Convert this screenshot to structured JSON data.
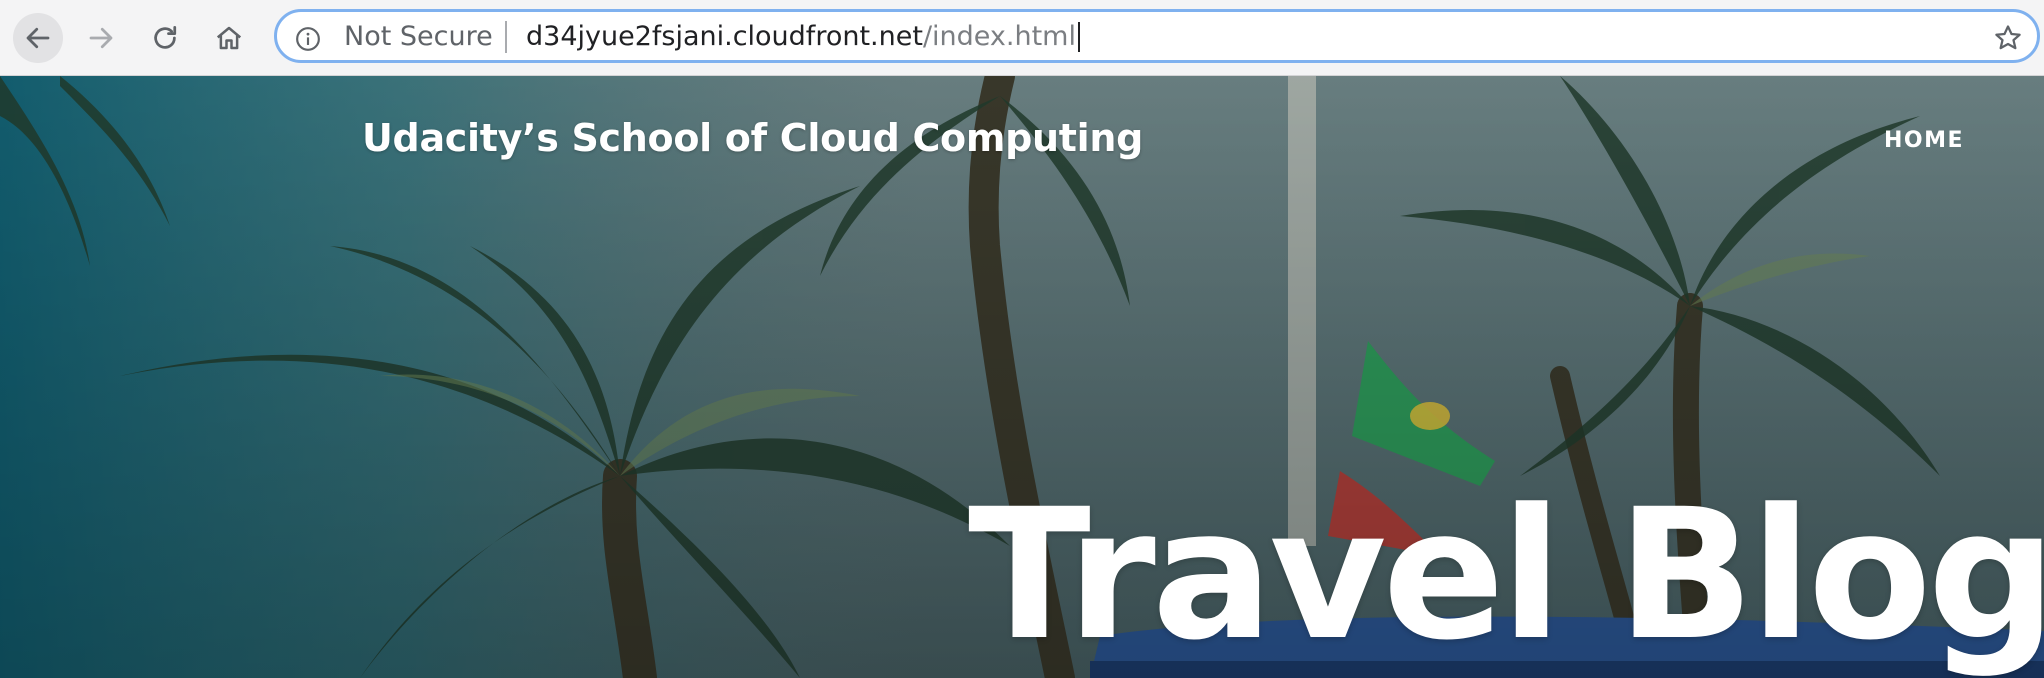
{
  "browser": {
    "security_label": "Not Secure",
    "url_host": "d34jyue2fsjani.cloudfront.net",
    "url_path": "/index.html",
    "icons": {
      "back": "arrow-left-icon",
      "forward": "arrow-right-icon",
      "reload": "reload-icon",
      "home": "home-icon",
      "info": "info-icon",
      "bookmark": "star-icon"
    }
  },
  "site": {
    "title": "Udacity’s School of Cloud Computing",
    "nav": [
      {
        "label": "HOME"
      }
    ],
    "hero": {
      "heading": "Travel Blog"
    }
  },
  "colors": {
    "omnibox_border": "#7fb1ef",
    "hero_text": "#ffffff",
    "toolbar_bg": "#f4f4f5"
  }
}
